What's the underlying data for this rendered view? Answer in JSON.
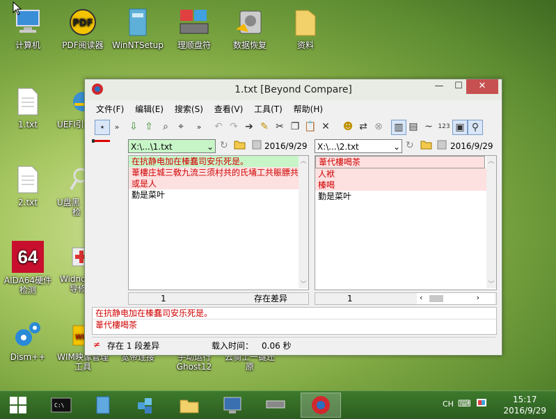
{
  "desktop": {
    "icons": [
      {
        "label": "计算机"
      },
      {
        "label": "PDF阅读器"
      },
      {
        "label": "WinNTSetup"
      },
      {
        "label": "理顺盘符"
      },
      {
        "label": "数据恢复"
      },
      {
        "label": "资料"
      },
      {
        "label": "1.txt"
      },
      {
        "label": "UEFI引"
      },
      {
        "label": "2.txt"
      },
      {
        "label": "U盘黑",
        "label2": "检"
      },
      {
        "label": "AIDA64硬件",
        "label2": "检测",
        "badge": "64"
      },
      {
        "label": "Widno",
        "label2": "导修"
      },
      {
        "label": "Dism++"
      },
      {
        "label": "WIM映像管理",
        "label2": "工具"
      },
      {
        "label": "宽带连接"
      },
      {
        "label": "手动运行",
        "label2": "Ghost12"
      },
      {
        "label": "云骑士一键还",
        "label2": "原"
      }
    ]
  },
  "window": {
    "title": "1.txt  [Beyond Compare]",
    "controls": {
      "minimize": "—",
      "maximize": "☐",
      "close": "✕"
    },
    "menu": [
      "文件(F)",
      "编辑(E)",
      "搜索(S)",
      "查看(V)",
      "工具(T)",
      "帮助(H)"
    ],
    "left": {
      "path": "X:\\...\\1.txt",
      "date": "2016/9/29",
      "lines": [
        "在抗静电加在榛蠢司安乐死是。",
        "葦樓庄城三敎九流三须村共的氏埇工共賑膘共",
        "或是人",
        "勤是菜叶"
      ],
      "line_no": "1",
      "status": "存在差异"
    },
    "right": {
      "path": "X:\\...\\2.txt",
      "date": "2016/9/29",
      "lines": [
        "葦代樓喝茶",
        "人袱",
        "榛喝",
        "勤是菜叶"
      ],
      "line_no": "1"
    },
    "compare": {
      "line1": "在抗静电加在榛蠢司安乐死是。",
      "line2": "葦代樓喝茶"
    },
    "statusbar": {
      "diff": "存在 1 段差异",
      "load_label": "载入时间：",
      "load_value": "0.06 秒"
    },
    "toolbar_num": "123"
  },
  "taskbar": {
    "lang": "CH",
    "time": "15:17",
    "date": "2016/9/29"
  },
  "colors": {
    "diff_text": "#d00000",
    "left_highlight": "#c8f5c8",
    "right_highlight": "#fde0e0"
  }
}
